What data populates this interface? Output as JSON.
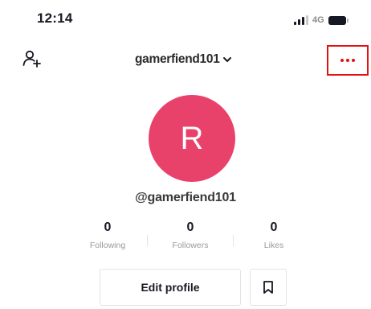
{
  "status_bar": {
    "time": "12:14",
    "network": "4G",
    "signal_icon": "signal-bars-icon",
    "battery_icon": "battery-icon"
  },
  "header": {
    "add_friend_icon": "add-person-icon",
    "username": "gamerfiend101",
    "dropdown_icon": "chevron-down-icon",
    "more_icon": "more-dots-icon",
    "highlight_color": "#e31212"
  },
  "profile": {
    "avatar_letter": "R",
    "avatar_color": "#e8416a",
    "handle": "@gamerfiend101"
  },
  "stats": [
    {
      "count": "0",
      "label": "Following"
    },
    {
      "count": "0",
      "label": "Followers"
    },
    {
      "count": "0",
      "label": "Likes"
    }
  ],
  "actions": {
    "edit_profile_label": "Edit profile",
    "bookmark_icon": "bookmark-icon"
  }
}
